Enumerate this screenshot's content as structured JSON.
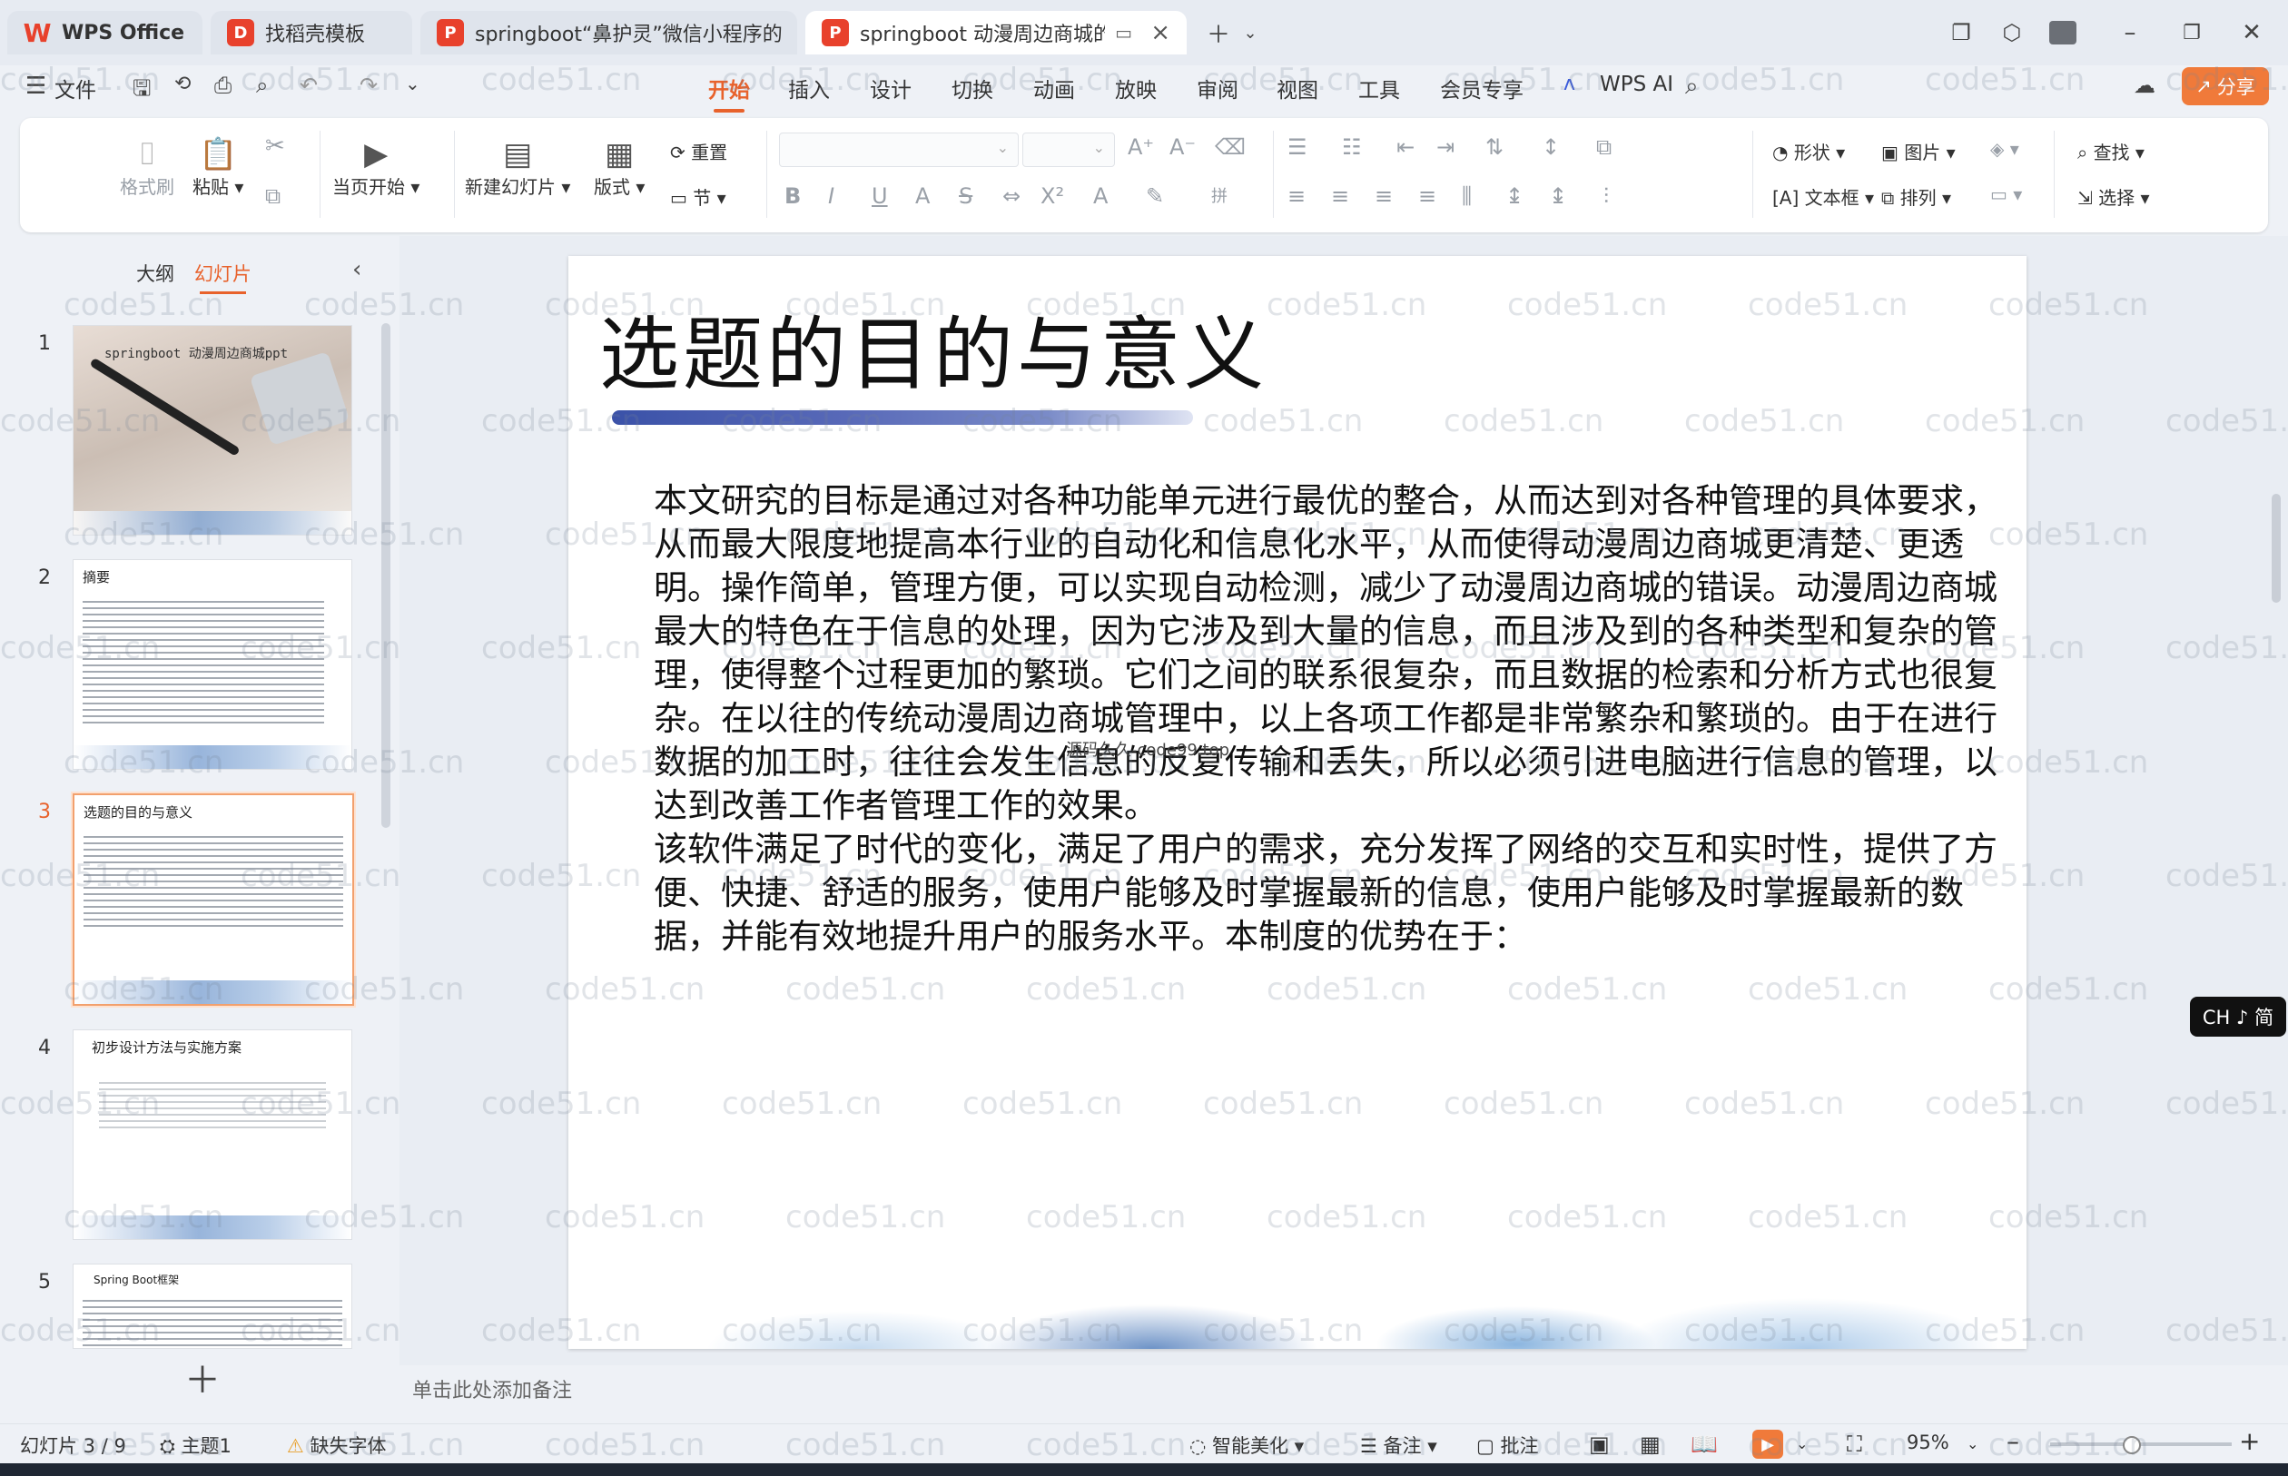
{
  "titlebar": {
    "tabs": [
      {
        "label": "WPS Office",
        "logo": "W",
        "color": "#e8412c"
      },
      {
        "label": "找稻壳模板",
        "logo": "D",
        "color": "#e8412c"
      },
      {
        "label": "springboot“鼻护灵”微信小程序的",
        "logo": "P",
        "color": "#e8412c"
      },
      {
        "label": "springboot 动漫周边商城的",
        "logo": "P",
        "color": "#e8412c"
      }
    ]
  },
  "menu": {
    "file": "文件",
    "items": [
      "开始",
      "插入",
      "设计",
      "切换",
      "动画",
      "放映",
      "审阅",
      "视图",
      "工具",
      "会员专享"
    ],
    "wps_ai": "WPS AI",
    "share": "分享"
  },
  "ribbon": {
    "format_painter": "格式刷",
    "paste": "粘贴",
    "from_current": "当页开始",
    "new_slide": "新建幻灯片",
    "layout": "版式",
    "reset": "重置",
    "section": "节",
    "shape": "形状",
    "picture": "图片",
    "textbox": "文本框",
    "arrange": "排列",
    "find": "查找",
    "select": "选择"
  },
  "panel": {
    "outline": "大纲",
    "slides": "幻灯片",
    "thumbnails": [
      {
        "num": "1",
        "title": "springboot 动漫周边商城ppt"
      },
      {
        "num": "2",
        "title": "摘要"
      },
      {
        "num": "3",
        "title": "选题的目的与意义"
      },
      {
        "num": "4",
        "title": "初步设计方法与实施方案"
      },
      {
        "num": "5",
        "title": "Spring Boot框架"
      }
    ]
  },
  "slide": {
    "title": "选题的目的与意义",
    "paragraphs": [
      "本文研究的目标是通过对各种功能单元进行最优的整合，从而达到对各种管理的具体要求，从而最大限度地提高本行业的自动化和信息化水平，从而使得动漫周边商城更清楚、更透明。操作简单，管理方便，可以实现自动检测，减少了动漫周边商城的错误。动漫周边商城最大的特色在于信息的处理，因为它涉及到大量的信息，而且涉及到的各种类型和复杂的管理，使得整个过程更加的繁琐。它们之间的联系很复杂，而且数据的检索和分析方式也很复杂。在以往的传统动漫周边商城管理中，以上各项工作都是非常繁杂和繁琐的。由于在进行数据的加工时，往往会发生信息的反复传输和丢失，所以必须引进电脑进行信息的管理，以达到改善工作者管理工作的效果。",
      "该软件满足了时代的变化，满足了用户的需求，充分发挥了网络的交互和实时性，提供了方便、快捷、舒适的服务，使用户能够及时掌握最新的信息，使用户能够及时掌握最新的数据，并能有效地提升用户的服务水平。本制度的优势在于："
    ],
    "watermark": "源码久久-code99.top"
  },
  "notes_placeholder": "单击此处添加备注",
  "ime": "CH ♪ 简",
  "status": {
    "slide_pos": "幻灯片 3 / 9",
    "theme": "主题1",
    "missing_font": "缺失字体",
    "beautify": "智能美化",
    "notes": "备注",
    "comments": "批注",
    "zoom": "95%"
  },
  "watermark_text": "code51.cn",
  "colors": {
    "accent": "#e8622c",
    "share": "#f07a3a"
  }
}
